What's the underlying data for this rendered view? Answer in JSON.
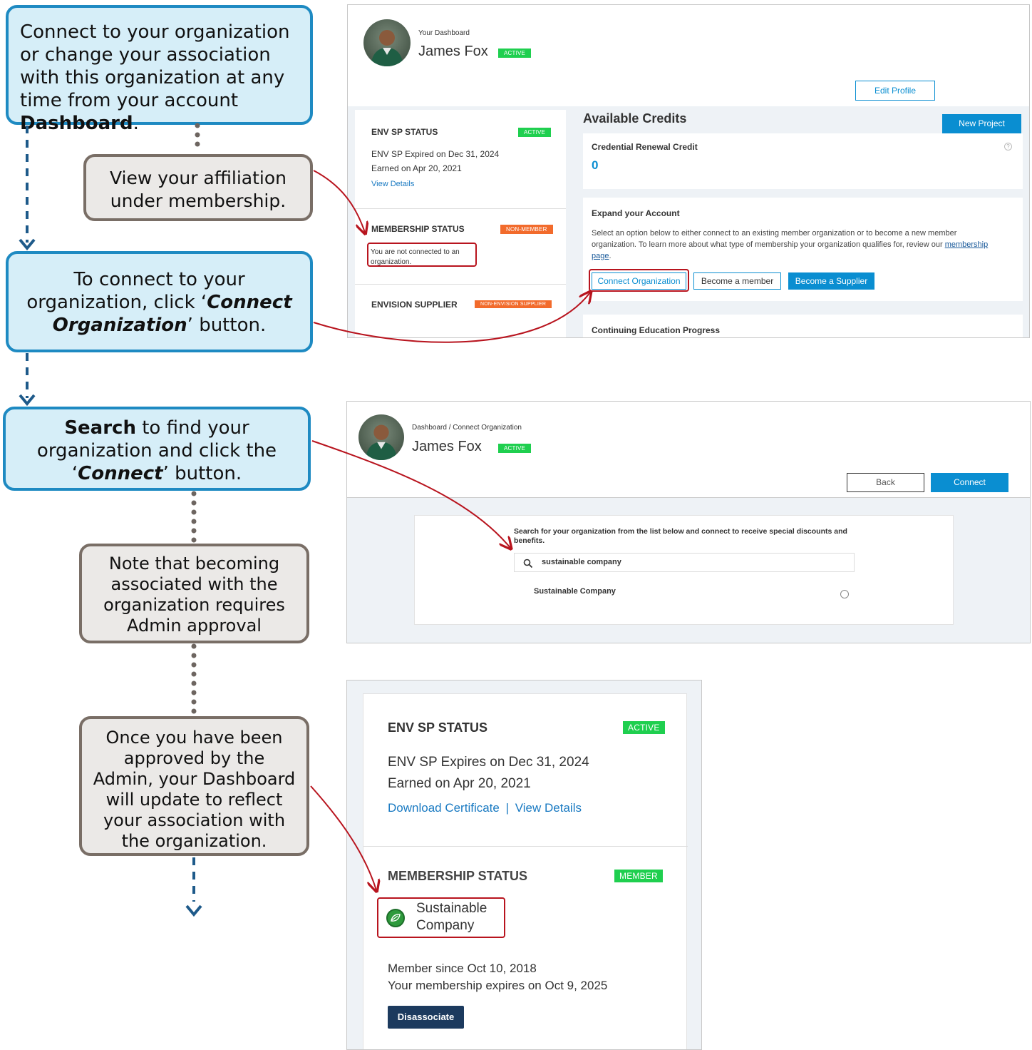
{
  "callouts": {
    "c1_pre": "Connect to your organization or change your association with this organization at any time from your account ",
    "c1_bold": "Dashboard",
    "c1_post": ".",
    "c2": "View your affiliation under membership.",
    "c3_pre": "To connect to your organization, click ‘",
    "c3_bold": "Connect Organization",
    "c3_post": "’ button.",
    "c4_bold": "Search",
    "c4_mid": " to find your organization and click the ‘",
    "c4_bold2": "Connect",
    "c4_post": "’ button.",
    "c5": "Note that becoming associated with the organization requires Admin approval",
    "c6": "Once you have been approved by the Admin, your Dashboard will update to reflect your association with the organization."
  },
  "dashboard": {
    "breadcrumb": "Your Dashboard",
    "user_name": "James Fox",
    "user_status": "ACTIVE",
    "edit_profile": "Edit Profile",
    "env_sp": {
      "title": "ENV SP STATUS",
      "badge": "ACTIVE",
      "line1": "ENV SP Expired on Dec 31, 2024",
      "line2": "Earned on Apr 20, 2021",
      "link": "View Details"
    },
    "membership": {
      "title": "MEMBERSHIP STATUS",
      "badge": "NON-MEMBER",
      "text": "You are not connected to an organization."
    },
    "supplier": {
      "title": "ENVISION SUPPLIER",
      "badge": "NON-ENVISION SUPPLIER"
    },
    "credits": {
      "heading": "Available Credits",
      "new_project": "New Project",
      "renewal_label": "Credential Renewal Credit",
      "renewal_value": "0",
      "help_icon": "?"
    },
    "expand": {
      "heading": "Expand your Account",
      "desc": "Select an option below to either connect to an existing member organization or to become a new member organization. To learn more about what type of membership your organization qualifies for, review our ",
      "link": "membership page",
      "desc_end": ".",
      "btn_connect": "Connect Organization",
      "btn_member": "Become a member",
      "btn_supplier": "Become a Supplier"
    },
    "ce_progress": "Continuing Education Progress"
  },
  "connect_page": {
    "breadcrumb": "Dashboard / Connect Organization",
    "user_name": "James Fox",
    "user_status": "ACTIVE",
    "back": "Back",
    "connect": "Connect",
    "instructions": "Search for your organization from the list below and connect to receive special discounts and benefits.",
    "search_value": "sustainable company",
    "result": "Sustainable Company"
  },
  "updated": {
    "env_title": "ENV SP STATUS",
    "env_badge": "ACTIVE",
    "env_line1": "ENV SP Expires on Dec 31, 2024",
    "env_line2": "Earned on Apr 20, 2021",
    "download": "Download Certificate",
    "sep": "|",
    "view": "View Details",
    "mem_title": "MEMBERSHIP STATUS",
    "mem_badge": "MEMBER",
    "org_name": "Sustainable Company",
    "member_since": "Member since Oct 10, 2018",
    "expires": "Your membership expires on Oct 9, 2025",
    "disassociate": "Disassociate"
  },
  "colors": {
    "callout_blue_bg": "#d6eef8",
    "callout_blue_border": "#1e8ac2",
    "callout_gray_bg": "#ebe9e7",
    "callout_gray_border": "#796e66",
    "arrow_red": "#b8141e",
    "status_green": "#1fcf4f",
    "status_orange": "#f26b2c",
    "primary_blue": "#0a8ed1",
    "navy": "#1c3a5e"
  }
}
